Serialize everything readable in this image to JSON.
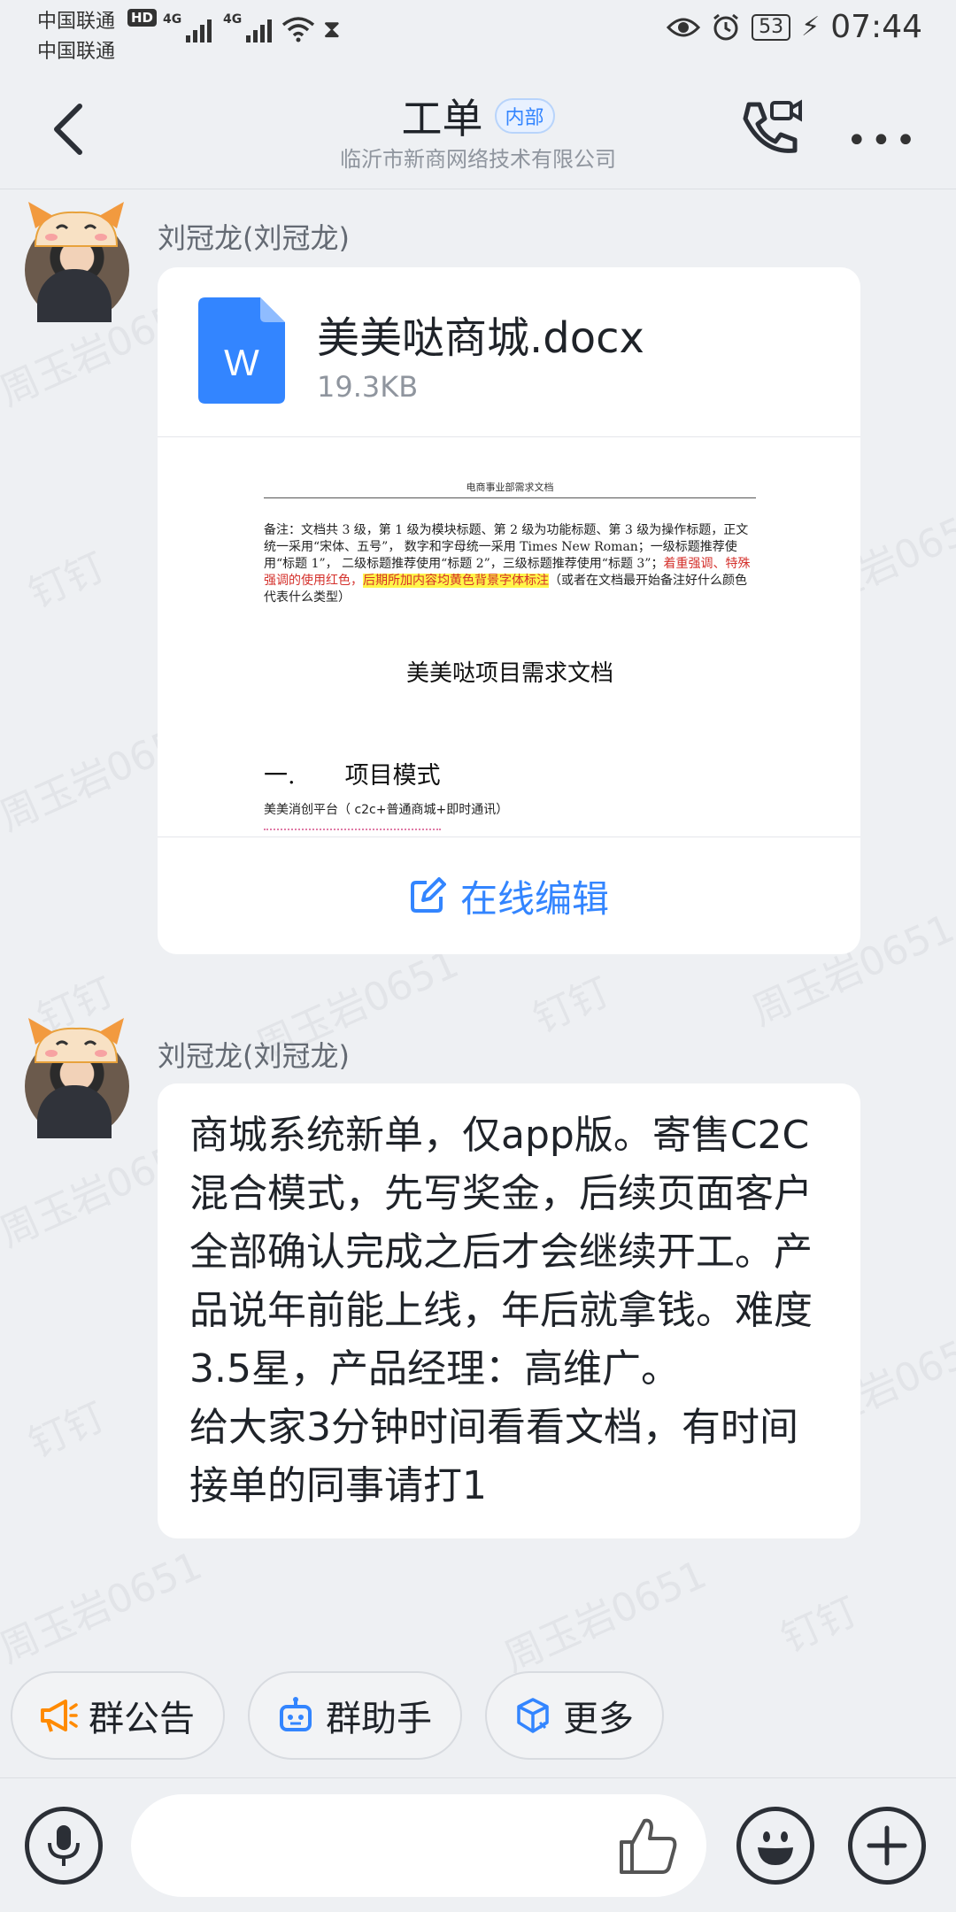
{
  "status_bar": {
    "carrier1": "中国联通",
    "carrier2": "中国联通",
    "hd": "HD",
    "net1": "4G",
    "net2": "4G",
    "battery": "53",
    "time": "07:44"
  },
  "header": {
    "title": "工单",
    "tag": "内部",
    "subtitle": "临沂市新商网络技术有限公司"
  },
  "watermark": {
    "name": "周玉岩0651",
    "app": "钉钉"
  },
  "messages": [
    {
      "sender": "刘冠龙(刘冠龙)",
      "file": {
        "icon_letter": "W",
        "name": "美美哒商城.docx",
        "size": "19.3KB",
        "preview": {
          "header": "电商事业部需求文档",
          "note_normal": "备注：文档共 3 级，第 1 级为模块标题、第 2 级为功能标题、第 3 级为操作标题，正文统一采用“宋体、五号”， 数字和字母统一采用 Times New Roman；一级标题推荐使用“标题 1”， 二级标题推荐使用“标题 2”，三级标题推荐使用“标题 3”；",
          "note_red": "着重强调、特殊强调的使用红色，",
          "note_highlight": "后期所加内容均黄色背景字体标注",
          "note_tail": "（或者在文档最开始备注好什么颜色代表什么类型）",
          "doc_title": "美美哒项目需求文档",
          "h1_num": "一.",
          "h1_text": "项目模式",
          "line1": "美美消创平台（ c2c+普通商城+即时通讯）"
        },
        "action": "在线编辑"
      }
    },
    {
      "sender": "刘冠龙(刘冠龙)",
      "text": "商城系统新单，仅app版。寄售C2C混合模式，先写奖金，后续页面客户全部确认完成之后才会继续开工。产品说年前能上线，年后就拿钱。难度3.5星，产品经理：高维广。\n给大家3分钟时间看看文档，有时间接单的同事请打1"
    }
  ],
  "quick_actions": [
    {
      "label": "群公告",
      "icon": "megaphone-icon"
    },
    {
      "label": "群助手",
      "icon": "robot-icon"
    },
    {
      "label": "更多",
      "icon": "cube-icon"
    }
  ],
  "input": {
    "value": "",
    "placeholder": ""
  },
  "colors": {
    "accent": "#3385ff",
    "background": "#eef0f3",
    "bubble": "#ffffff",
    "chip_icon_orange": "#ff8a00",
    "chip_icon_blue": "#3385ff"
  }
}
